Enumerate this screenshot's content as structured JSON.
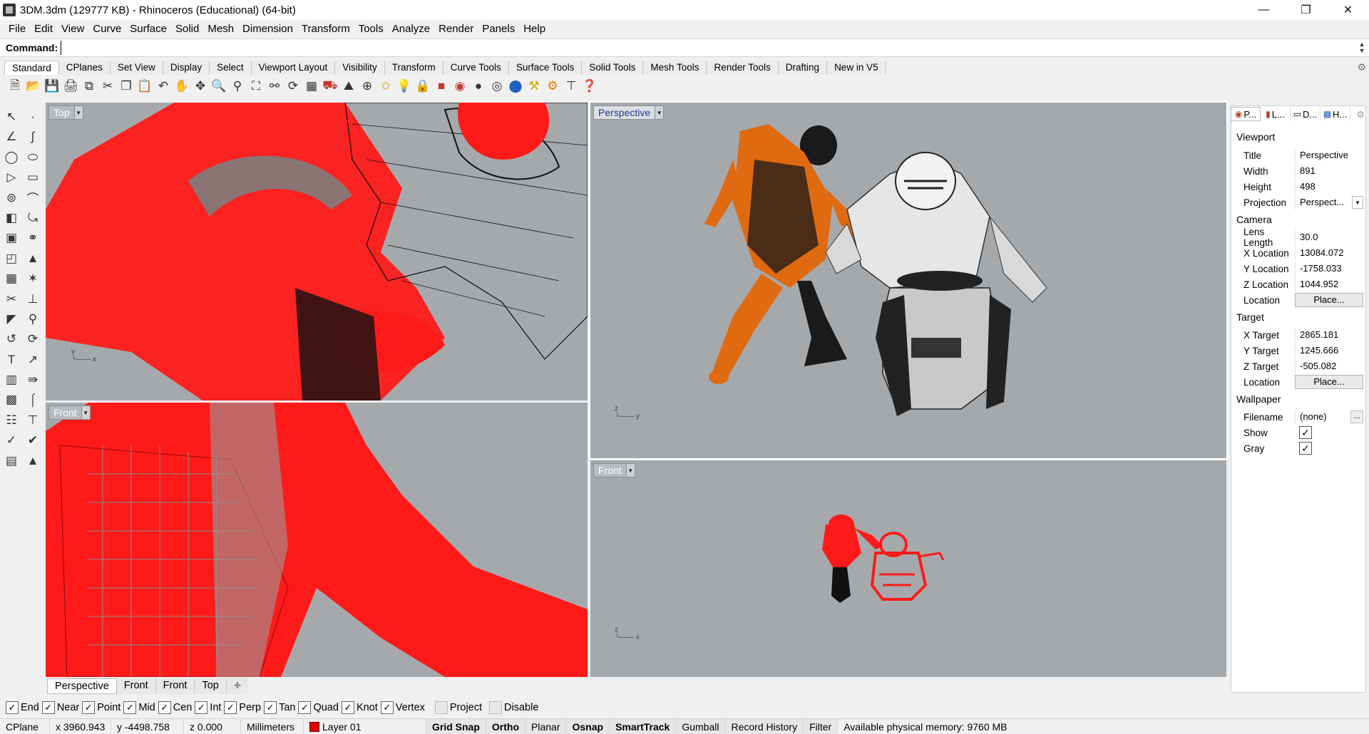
{
  "window": {
    "title": "3DM.3dm (129777 KB) - Rhinoceros (Educational) (64-bit)",
    "minimize_icon": "minimize-icon",
    "maximize_icon": "restore-icon",
    "close_icon": "close-icon"
  },
  "menu": [
    "File",
    "Edit",
    "View",
    "Curve",
    "Surface",
    "Solid",
    "Mesh",
    "Dimension",
    "Transform",
    "Tools",
    "Analyze",
    "Render",
    "Panels",
    "Help"
  ],
  "command": {
    "label": "Command:",
    "value": ""
  },
  "toolbar_tabs": [
    "Standard",
    "CPlanes",
    "Set View",
    "Display",
    "Select",
    "Viewport Layout",
    "Visibility",
    "Transform",
    "Curve Tools",
    "Surface Tools",
    "Solid Tools",
    "Mesh Tools",
    "Render Tools",
    "Drafting",
    "New in V5"
  ],
  "active_toolbar_tab": "Standard",
  "viewports": {
    "top_left": {
      "label": "Top"
    },
    "bottom_left": {
      "label": "Front"
    },
    "perspective": {
      "label": "Perspective"
    },
    "front": {
      "label": "Front"
    }
  },
  "viewport_tabs": [
    "Perspective",
    "Front",
    "Front",
    "Top"
  ],
  "panel": {
    "tabs": [
      "P...",
      "L...",
      "D...",
      "H..."
    ],
    "sections": {
      "viewport": "Viewport",
      "camera": "Camera",
      "target": "Target",
      "wallpaper": "Wallpaper"
    },
    "viewport_rows": [
      {
        "key": "Title",
        "value": "Perspective"
      },
      {
        "key": "Width",
        "value": "891"
      },
      {
        "key": "Height",
        "value": "498"
      },
      {
        "key": "Projection",
        "value": "Perspect..."
      }
    ],
    "camera_rows": [
      {
        "key": "Lens Length",
        "value": "30.0"
      },
      {
        "key": "X Location",
        "value": "13084.072"
      },
      {
        "key": "Y Location",
        "value": "-1758.033"
      },
      {
        "key": "Z Location",
        "value": "1044.952"
      },
      {
        "key": "Location",
        "value": "Place..."
      }
    ],
    "target_rows": [
      {
        "key": "X Target",
        "value": "2865.181"
      },
      {
        "key": "Y Target",
        "value": "1245.666"
      },
      {
        "key": "Z Target",
        "value": "-505.082"
      },
      {
        "key": "Location",
        "value": "Place..."
      }
    ],
    "wallpaper_rows": [
      {
        "key": "Filename",
        "value": "(none)"
      },
      {
        "key": "Show",
        "checked": true
      },
      {
        "key": "Gray",
        "checked": true
      }
    ]
  },
  "osnaps": [
    {
      "label": "End",
      "checked": true
    },
    {
      "label": "Near",
      "checked": true
    },
    {
      "label": "Point",
      "checked": true
    },
    {
      "label": "Mid",
      "checked": true
    },
    {
      "label": "Cen",
      "checked": true
    },
    {
      "label": "Int",
      "checked": true
    },
    {
      "label": "Perp",
      "checked": true
    },
    {
      "label": "Tan",
      "checked": true
    },
    {
      "label": "Quad",
      "checked": true
    },
    {
      "label": "Knot",
      "checked": true
    },
    {
      "label": "Vertex",
      "checked": true
    },
    {
      "label": "Project",
      "checked": false
    },
    {
      "label": "Disable",
      "checked": false
    }
  ],
  "status": {
    "cplane": "CPlane",
    "x": "x 3960.943",
    "y": "y -4498.758",
    "z": "z 0.000",
    "units": "Millimeters",
    "layer": "Layer 01",
    "layer_color": "#e00000",
    "grid_snap": "Grid Snap",
    "ortho": "Ortho",
    "planar": "Planar",
    "osnap": "Osnap",
    "smarttrack": "SmartTrack",
    "gumball": "Gumball",
    "record_history": "Record History",
    "filter": "Filter",
    "memory": "Available physical memory: 9760 MB"
  },
  "colors": {
    "viewport_bg": "#a5a9ac",
    "wire_red": "#ff1a1a",
    "wire_black": "#111111",
    "robot_orange": "#e06a10"
  }
}
